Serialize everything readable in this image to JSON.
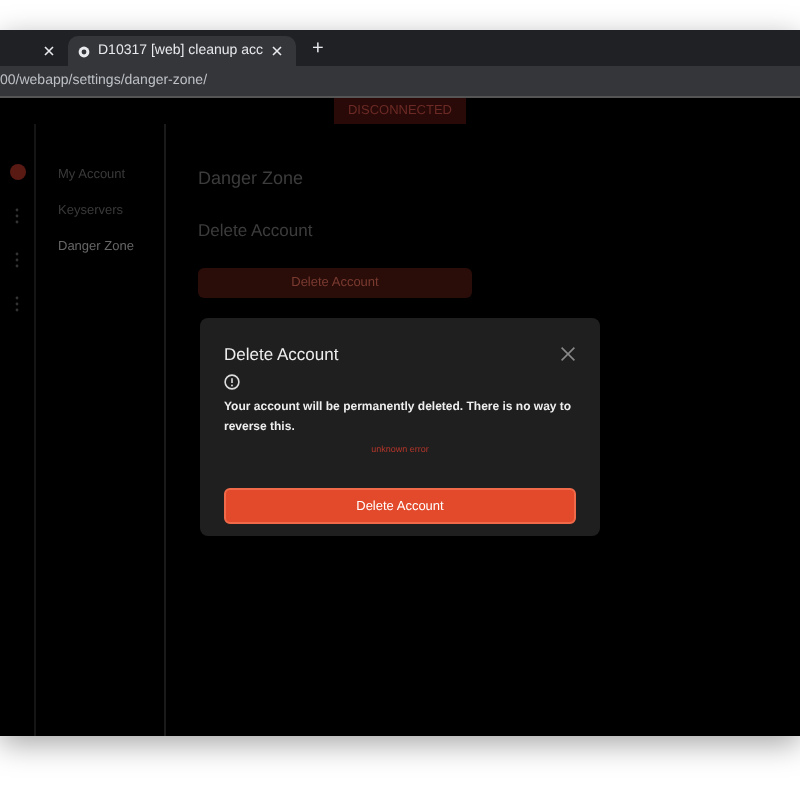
{
  "browser": {
    "tabs": [
      {
        "selected": false
      },
      {
        "title": "D10317 [web] cleanup acc",
        "selected": true
      }
    ],
    "new_tab": "+",
    "address": "00/webapp/settings/danger-zone/"
  },
  "status_badge": "DISCONNECTED",
  "sidebar": {
    "items": [
      {
        "label": "My Account",
        "selected": false
      },
      {
        "label": "Keyservers",
        "selected": false
      },
      {
        "label": "Danger Zone",
        "selected": true
      }
    ]
  },
  "content": {
    "heading": "Danger Zone",
    "section": "Delete Account",
    "button": "Delete Account"
  },
  "dialog": {
    "title": "Delete Account",
    "message": "Your account will be permanently deleted. There is no way to reverse this.",
    "error": "unknown error",
    "confirm": "Delete Account"
  }
}
